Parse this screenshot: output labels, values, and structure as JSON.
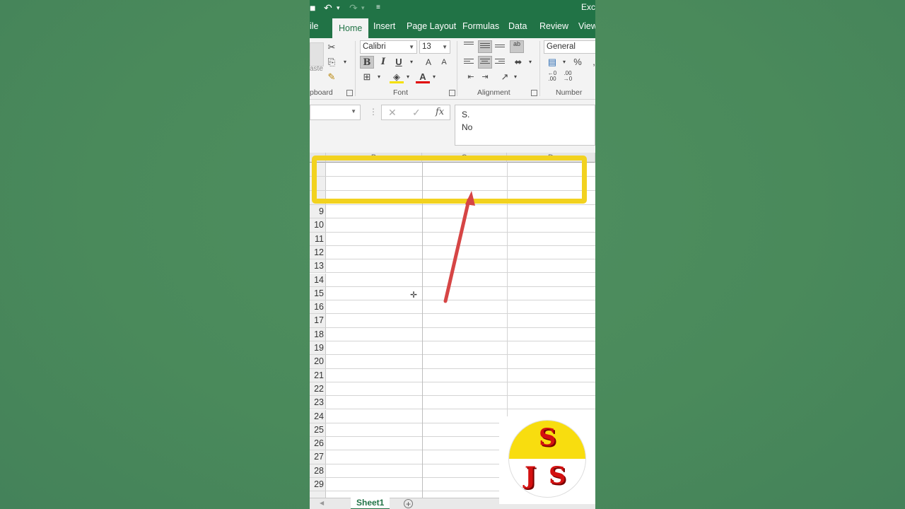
{
  "titlebar": {
    "title": "Exc",
    "qat": {
      "save_icon": "save-icon",
      "undo_icon": "undo-icon",
      "redo_icon": "redo-icon",
      "customize_icon": "customize-qat-icon"
    }
  },
  "tabs": [
    {
      "label": "ile"
    },
    {
      "label": "Home",
      "active": true
    },
    {
      "label": "Insert"
    },
    {
      "label": "Page Layout"
    },
    {
      "label": "Formulas"
    },
    {
      "label": "Data"
    },
    {
      "label": "Review"
    },
    {
      "label": "View"
    }
  ],
  "ribbon": {
    "clipboard": {
      "paste_label": "aste",
      "group_label": "pboard"
    },
    "font": {
      "name": "Calibri",
      "size": "13",
      "bold": "B",
      "italic": "I",
      "underline": "U",
      "grow": "A",
      "shrink": "A",
      "font_color": "A",
      "group_label": "Font"
    },
    "alignment": {
      "wrap": "ab",
      "group_label": "Alignment"
    },
    "number": {
      "format": "General",
      "percent": "%",
      "group_label": "Number"
    }
  },
  "formula_bar": {
    "name_box": "",
    "cancel": "✕",
    "enter": "✓",
    "fx": "fx",
    "content_line1": "S.",
    "content_line2": "No"
  },
  "grid": {
    "columns": [
      "B",
      "C",
      "D"
    ],
    "hidden_rows": [
      "",
      "",
      ""
    ],
    "rows": [
      "9",
      "10",
      "11",
      "12",
      "13",
      "14",
      "15",
      "16",
      "17",
      "18",
      "19",
      "20",
      "21",
      "22",
      "23",
      "24",
      "25",
      "26",
      "27",
      "28",
      "29"
    ]
  },
  "sheets": {
    "active": "Sheet1",
    "add": "+"
  },
  "logo": {
    "top_letter": "S",
    "bottom_left": "J",
    "bottom_right": "S"
  },
  "colors": {
    "excel_green": "#217346",
    "highlight_yellow": "#f2d21f",
    "arrow_red": "#d64545",
    "background_green": "#4a8a5b"
  }
}
